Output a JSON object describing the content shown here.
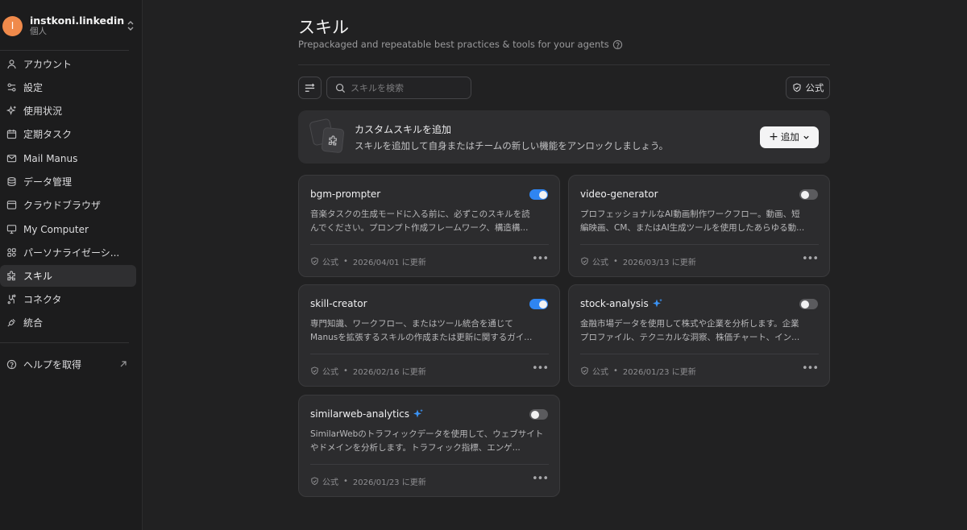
{
  "account": {
    "initial": "I",
    "name": "instkoni.linkedin",
    "type": "個人"
  },
  "nav": {
    "account": "アカウント",
    "settings": "設定",
    "usage": "使用状況",
    "scheduled": "定期タスク",
    "mail": "Mail Manus",
    "data": "データ管理",
    "browser": "クラウドブラウザ",
    "computer": "My Computer",
    "personalization": "パーソナライゼーシ...",
    "skills": "スキル",
    "connectors": "コネクタ",
    "integrations": "統合",
    "help": "ヘルプを取得"
  },
  "header": {
    "title": "スキル",
    "subtitle": "Prepackaged and repeatable best practices & tools for your agents"
  },
  "toolbar": {
    "search_placeholder": "スキルを検索",
    "official_label": "公式"
  },
  "banner": {
    "title": "カスタムスキルを追加",
    "desc": "スキルを追加して自身またはチームの新しい機能をアンロックしましょう。",
    "add_label": "追加"
  },
  "skills": [
    {
      "name": "bgm-prompter",
      "enabled": true,
      "line1": "音楽タスクの生成モードに入る前に、必ずこのスキルを読",
      "line2": "んでください。プロンプト作成フレームワーク、構造構...",
      "badge": "公式",
      "updated": "2026/04/01 に更新"
    },
    {
      "name": "video-generator",
      "enabled": false,
      "line1": "プロフェッショナルなAI動画制作ワークフロー。動画、短",
      "line2": "編映画、CM、またはAI生成ツールを使用したあらゆる動...",
      "badge": "公式",
      "updated": "2026/03/13 に更新"
    },
    {
      "name": "skill-creator",
      "enabled": true,
      "line1": "専門知識、ワークフロー、またはツール統合を通じて",
      "line2": "Manusを拡張するスキルの作成または更新に関するガイ...",
      "badge": "公式",
      "updated": "2026/02/16 に更新"
    },
    {
      "name": "stock-analysis",
      "enabled": false,
      "line1": "金融市場データを使用して株式や企業を分析します。企業",
      "line2": "プロファイル、テクニカルな洞察、株価チャート、イン...",
      "badge": "公式",
      "updated": "2026/01/23 に更新"
    },
    {
      "name": "similarweb-analytics",
      "enabled": false,
      "line1": "SimilarWebのトラフィックデータを使用して、ウェブサイト",
      "line2": "やドメインを分析します。トラフィック指標、エンゲ...",
      "badge": "公式",
      "updated": "2026/01/23 に更新"
    }
  ],
  "colors": {
    "accent": "#2f85f2",
    "avatar": "#f08a4b",
    "sparkle": "#3b94f6"
  }
}
